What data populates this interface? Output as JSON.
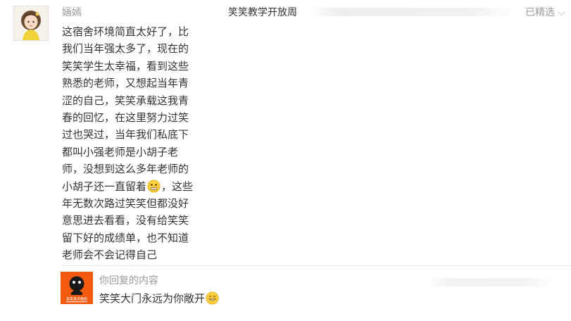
{
  "comment": {
    "author": "婳嫣",
    "article_title": "笑笑教学开放周",
    "featured_label": "已精选",
    "body_lines": [
      "这宿舍环境简直太好了，比",
      "我们当年强太多了，现在的",
      "笑笑学生太幸福，看到这些",
      "熟悉的老师，又想起当年青",
      "涩的自己，笑笑承载这我青",
      "春的回忆，在这里努力过笑",
      "过也哭过，当年我们私底下",
      "都叫小强老师是小胡子老",
      "师，没想到这么多年老师的"
    ],
    "line_with_emoji_before": "小胡子还一直留着",
    "line_with_emoji_after": "，这些",
    "body_lines_end": [
      "年无数次路过笑笑但都没好",
      "意思进去看看，没有给笑笑",
      "留下好的成绩单，也不知道",
      "老师会不会记得自己"
    ]
  },
  "reply": {
    "label": "你回复的内容",
    "text": "笑笑大门永远为你敞开",
    "avatar_caption": "笑笑美术教研"
  },
  "icons": {
    "featured_chevron": "chevron-down-icon",
    "inline_emoji": "grimace-emoji-icon",
    "reply_emoji": "grin-emoji-icon"
  },
  "colors": {
    "reply_avatar_bg": "#f25a0f",
    "muted_text": "#999999",
    "body_text": "#333333"
  }
}
